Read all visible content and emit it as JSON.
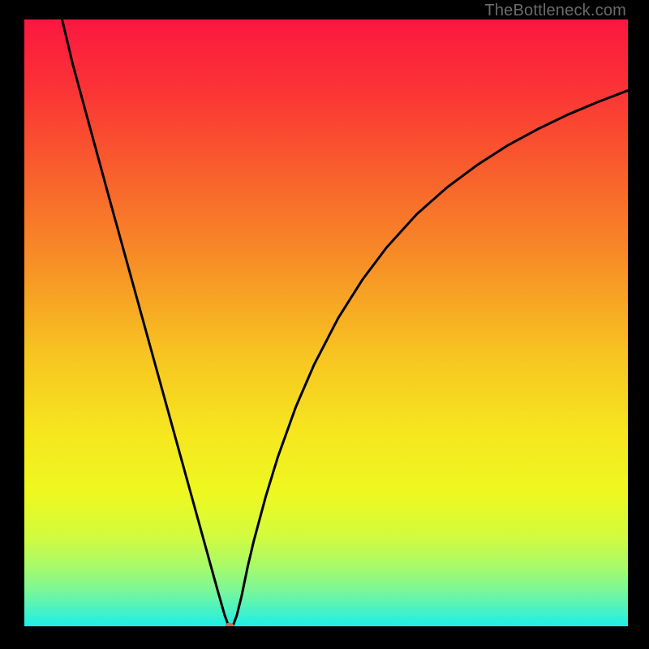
{
  "watermark": "TheBottleneck.com",
  "chart_data": {
    "type": "line",
    "title": "",
    "xlabel": "",
    "ylabel": "",
    "xlim": [
      0,
      100
    ],
    "ylim": [
      0,
      100
    ],
    "grid": false,
    "legend": false,
    "background_gradient": {
      "stops": [
        {
          "offset": 0.0,
          "color": "#fb1740"
        },
        {
          "offset": 0.12,
          "color": "#fb3535"
        },
        {
          "offset": 0.25,
          "color": "#f85f2d"
        },
        {
          "offset": 0.4,
          "color": "#f78f26"
        },
        {
          "offset": 0.55,
          "color": "#f7c421"
        },
        {
          "offset": 0.68,
          "color": "#f6e61f"
        },
        {
          "offset": 0.78,
          "color": "#eef820"
        },
        {
          "offset": 0.85,
          "color": "#d3fb3d"
        },
        {
          "offset": 0.9,
          "color": "#a9fa68"
        },
        {
          "offset": 0.94,
          "color": "#7cf796"
        },
        {
          "offset": 0.97,
          "color": "#4df3c0"
        },
        {
          "offset": 1.0,
          "color": "#1cefe8"
        }
      ]
    },
    "series": [
      {
        "name": "curve",
        "color": "#000000",
        "stroke_width": 3,
        "x": [
          6,
          8,
          10,
          12,
          14,
          16,
          18,
          20,
          22,
          24,
          26,
          28,
          29,
          30,
          31,
          32,
          33.2,
          33.8,
          34.0,
          34.6,
          35.2,
          36,
          37,
          38,
          40,
          42,
          45,
          48,
          52,
          56,
          60,
          65,
          70,
          75,
          80,
          85,
          90,
          95,
          100
        ],
        "y": [
          100,
          92.7,
          85.4,
          78.1,
          70.8,
          63.6,
          56.4,
          49.2,
          42.0,
          34.8,
          27.6,
          20.4,
          16.8,
          13.2,
          9.6,
          6.0,
          1.8,
          0.2,
          0.0,
          0.2,
          1.8,
          5.0,
          9.8,
          14.0,
          21.4,
          27.9,
          36.2,
          43.1,
          50.8,
          57.1,
          62.4,
          67.9,
          72.3,
          76.0,
          79.2,
          81.9,
          84.3,
          86.4,
          88.3
        ]
      }
    ],
    "marker": {
      "x": 34.0,
      "y": 0.0,
      "rx": 5.5,
      "ry": 4.5,
      "color": "#d46a5f"
    }
  }
}
